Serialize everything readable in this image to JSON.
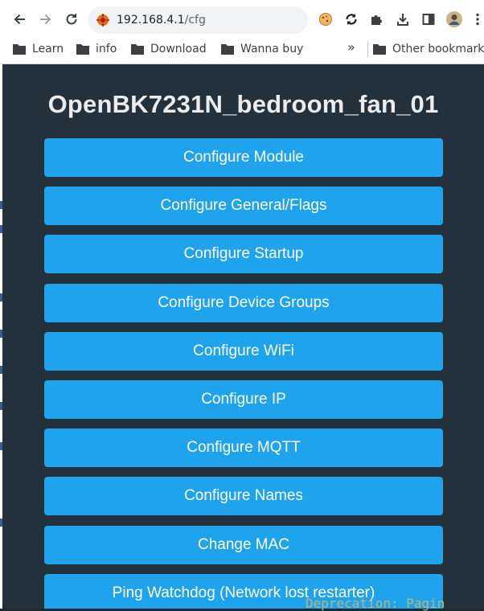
{
  "browser": {
    "url_host": "192.168.4.1",
    "url_path": "/cfg",
    "bookmarks": [
      "Learn",
      "info",
      "Download",
      "Wanna buy"
    ],
    "more_chevron": "»",
    "other_bookmarks": "Other bookmark"
  },
  "page": {
    "title": "OpenBK7231N_bedroom_fan_01",
    "buttons": [
      "Configure Module",
      "Configure General/Flags",
      "Configure Startup",
      "Configure Device Groups",
      "Configure WiFi",
      "Configure IP",
      "Configure MQTT",
      "Configure Names",
      "Change MAC",
      "Ping Watchdog (Network lost restarter)"
    ]
  },
  "background_text": "Deprecation: Pagin",
  "colors": {
    "page_bg": "#22313c",
    "button_bg": "#1fa3ec",
    "button_text": "#ffffff",
    "title_text": "#ececec"
  },
  "icons": [
    "back-arrow-icon",
    "forward-arrow-icon",
    "reload-icon",
    "site-icon",
    "cookie-icon",
    "sync-icon",
    "puzzle-icon",
    "download-icon",
    "sidebar-icon",
    "avatar",
    "kebab-menu-icon",
    "folder-icon"
  ]
}
